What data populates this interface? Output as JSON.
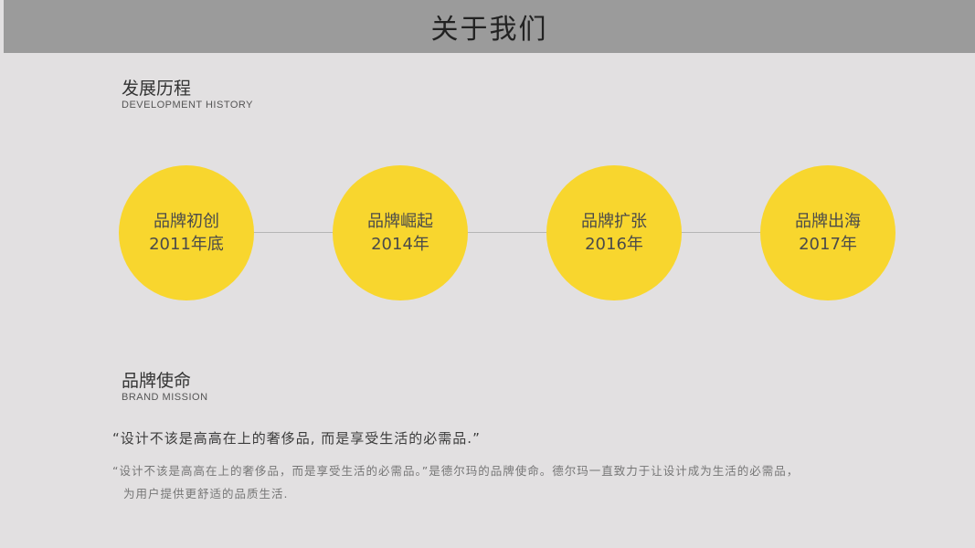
{
  "header": {
    "title": "关于我们"
  },
  "history": {
    "title": "发展历程",
    "subtitle": "DEVELOPMENT HISTORY"
  },
  "milestones": [
    {
      "title": "品牌初创",
      "date": "2011年底"
    },
    {
      "title": "品牌崛起",
      "date": "2014年"
    },
    {
      "title": "品牌扩张",
      "date": "2016年"
    },
    {
      "title": "品牌出海",
      "date": "2017年"
    }
  ],
  "mission": {
    "title": "品牌使命",
    "subtitle": "BRAND MISSION",
    "quote": "“设计不该是高高在上的奢侈品, 而是享受生活的必需品.”",
    "description_line1": "“设计不该是高高在上的奢侈品，而是享受生活的必需品。”是德尔玛的品牌使命。德尔玛一直致力于让设计成为生活的必需品，",
    "description_line2": "为用户提供更舒适的品质生活."
  },
  "colors": {
    "background": "#e2e0e1",
    "header": "#9b9b9b",
    "accent": "#f8d62e"
  }
}
